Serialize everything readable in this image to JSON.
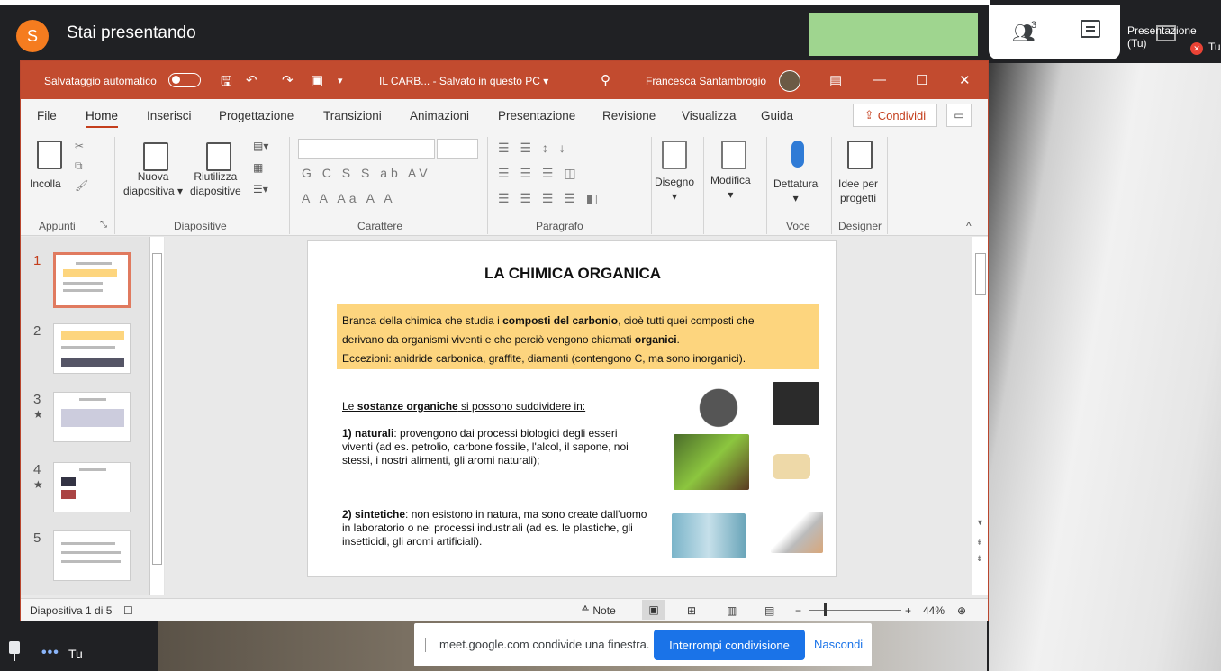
{
  "meet": {
    "avatar_letter": "S",
    "presenting_label": "Stai presentando",
    "participants_count": "3",
    "tile_label": "Presentazione (Tu)",
    "tile_name2": "Tu",
    "self_name": "Tu",
    "share_notice": "meet.google.com condivide una finestra.",
    "stop_share": "Interrompi condivisione",
    "hide": "Nascondi"
  },
  "ppt": {
    "autosave": "Salvataggio automatico",
    "doc_title": "IL CARB...  -  Salvato in questo PC  ▾",
    "user": "Francesca Santambrogio",
    "menu": [
      "File",
      "Home",
      "Inserisci",
      "Progettazione",
      "Transizioni",
      "Animazioni",
      "Presentazione",
      "Revisione",
      "Visualizza",
      "Guida"
    ],
    "share": "Condividi",
    "ribbon": {
      "incolla": "Incolla",
      "nuova": "Nuova",
      "diapositiva": "diapositiva",
      "riutilizza": "Riutilizza",
      "diapositive": "diapositive",
      "disegno": "Disegno",
      "modifica": "Modifica",
      "dettatura": "Dettatura",
      "idee1": "Idee per",
      "idee2": "progetti",
      "groups": [
        "Appunti",
        "Diapositive",
        "Carattere",
        "Paragrafo",
        "Voce",
        "Designer"
      ]
    },
    "status": {
      "slide_count": "Diapositiva 1 di 5",
      "notes": "Note",
      "zoom": "44%"
    }
  },
  "slide": {
    "title": "LA CHIMICA ORGANICA",
    "def_1": "Branca della chimica che studia i ",
    "def_bold1": "composti del carbonio",
    "def_2": ", cioè tutti quei composti che",
    "def_3": "derivano da organismi viventi e che perciò vengono chiamati ",
    "def_bold2": "organici",
    "def_4": ".",
    "def_5": "Eccezioni: anidride carbonica, graffite, diamanti (contengono C, ma sono inorganici).",
    "subs_a": "Le ",
    "subs_b": "sostanze organiche",
    "subs_c": " si possono suddividere in:",
    "nat_h": "1) naturali",
    "nat_t": ": provengono dai processi biologici degli esseri viventi (ad es. petrolio, carbone fossile, l'alcol, il sapone, noi stessi, i nostri alimenti, gli aromi naturali);",
    "sin_h": "2) sintetiche",
    "sin_t": ": non esistono in natura, ma sono create dall'uomo in laboratorio o nei processi industriali (ad es. le plastiche, gli insetticidi, gli aromi artificiali)."
  },
  "thumbnails": [
    {
      "num": "1",
      "star": ""
    },
    {
      "num": "2",
      "star": ""
    },
    {
      "num": "3",
      "star": "★"
    },
    {
      "num": "4",
      "star": "★"
    },
    {
      "num": "5",
      "star": ""
    }
  ]
}
